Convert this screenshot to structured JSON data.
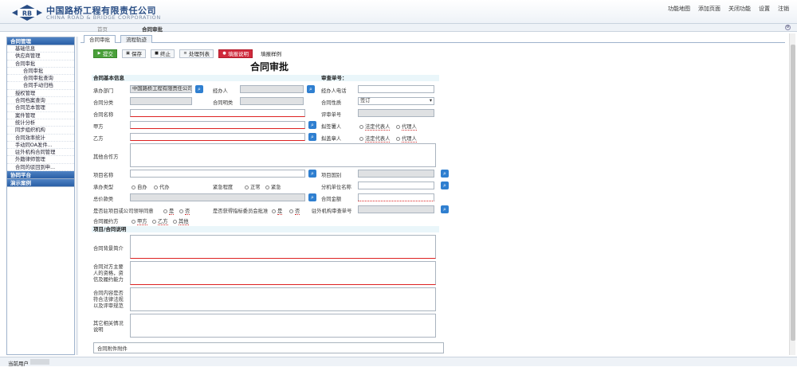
{
  "app": {
    "company_cn": "中国路桥工程有限责任公司",
    "company_en": "CHINA ROAD & BRIDGE CORPORATION",
    "logo_text": "RB",
    "brand_color": "#2b4f86",
    "top_links": [
      "功能地图",
      "添加页面",
      "关闭功能",
      "设置",
      "注销"
    ]
  },
  "nav": {
    "tabs": [
      "首页",
      "合同审批"
    ],
    "settings_icon": "gear-icon"
  },
  "sidebar": {
    "sections": [
      {
        "label": "合同管理",
        "items": [
          {
            "label": "基础信息",
            "level": 1
          },
          {
            "label": "供应商管理",
            "level": 1
          },
          {
            "label": "合同审批",
            "level": 1
          },
          {
            "label": "合同审批",
            "level": 2
          },
          {
            "label": "合同审批查询",
            "level": 2
          },
          {
            "label": "合同手动归档",
            "level": 2
          },
          {
            "label": "授权管理",
            "level": 1
          },
          {
            "label": "合同档案查询",
            "level": 1
          },
          {
            "label": "合同范本管理",
            "level": 1
          },
          {
            "label": "案件管理",
            "level": 1
          },
          {
            "label": "统计分析",
            "level": 1
          },
          {
            "label": "同步组织机构",
            "level": 1
          },
          {
            "label": "合同效率统计",
            "level": 1
          },
          {
            "label": "手动同OA发件...",
            "level": 1
          },
          {
            "label": "驻外机构合同管理",
            "level": 1
          },
          {
            "label": "外籍律师管理",
            "level": 1
          },
          {
            "label": "合同的驳回到申...",
            "level": 1
          }
        ]
      },
      {
        "label": "协同平台",
        "items": []
      },
      {
        "label": "演示案例",
        "items": []
      }
    ]
  },
  "content": {
    "tabs": [
      "合同审批",
      "流程轨迹"
    ],
    "toolbar": {
      "submit": "提交",
      "save": "保存",
      "stop": "终止",
      "process_list": "处理列表",
      "fill_note": "填报说明",
      "fill_example": "填报样例"
    },
    "title": "合同审批",
    "section_basic": "合同基本信息",
    "review_no_label": "审查单号：",
    "fields": {
      "dept_label": "承办部门",
      "dept_value": "中国路桥工程有限责任公司",
      "handler_label": "经办人",
      "handler_phone_label": "经办人电话",
      "contract_type_label": "合同分类",
      "contract_category_label": "合同明类",
      "contract_nature_label": "合同性质",
      "contract_nature_value": "签订",
      "contract_name_label": "合同名称",
      "review_no2_label": "评审单号",
      "party_a_label": "甲方",
      "proposed_signer_label": "拟签署人",
      "party_b_label": "乙方",
      "signer_label": "拟盖章人",
      "other_party_label": "其他合作方",
      "project_name_label": "项目名称",
      "project_country_label": "项目国别",
      "undertake_type_label": "承办类型",
      "urgency_label": "紧急程度",
      "branch_name_label": "分机单位名称",
      "total_amount_label": "总价款类",
      "contract_amount_label": "合同金额",
      "ptr_label": "是否驻项目或公司领导同意",
      "board_label": "是否获得指标委员会批准",
      "foreign_no_label": "驻外机构审查单号",
      "contract_type3_label": "合同履约方"
    },
    "radios": {
      "legal_rep": "法定代表人",
      "agent": "代理人",
      "self": "自办",
      "proxy": "代办",
      "normal": "正常",
      "urgent": "紧急",
      "yes": "是",
      "no": "否",
      "party_a": "甲方",
      "party_b": "乙方",
      "other": "其他"
    },
    "section_project": "项目/合同说明",
    "notes": {
      "intro_label": "合同背景简介",
      "ability_label": "合同对方主要人的资格，资信及履约能力",
      "risk_label": "合同内容是否符合法律法规以及评审规范",
      "other_label": "其它相关情况说明",
      "attachment_label": "合同附件附件"
    }
  },
  "footer": {
    "current_user_label": "当前用户"
  }
}
